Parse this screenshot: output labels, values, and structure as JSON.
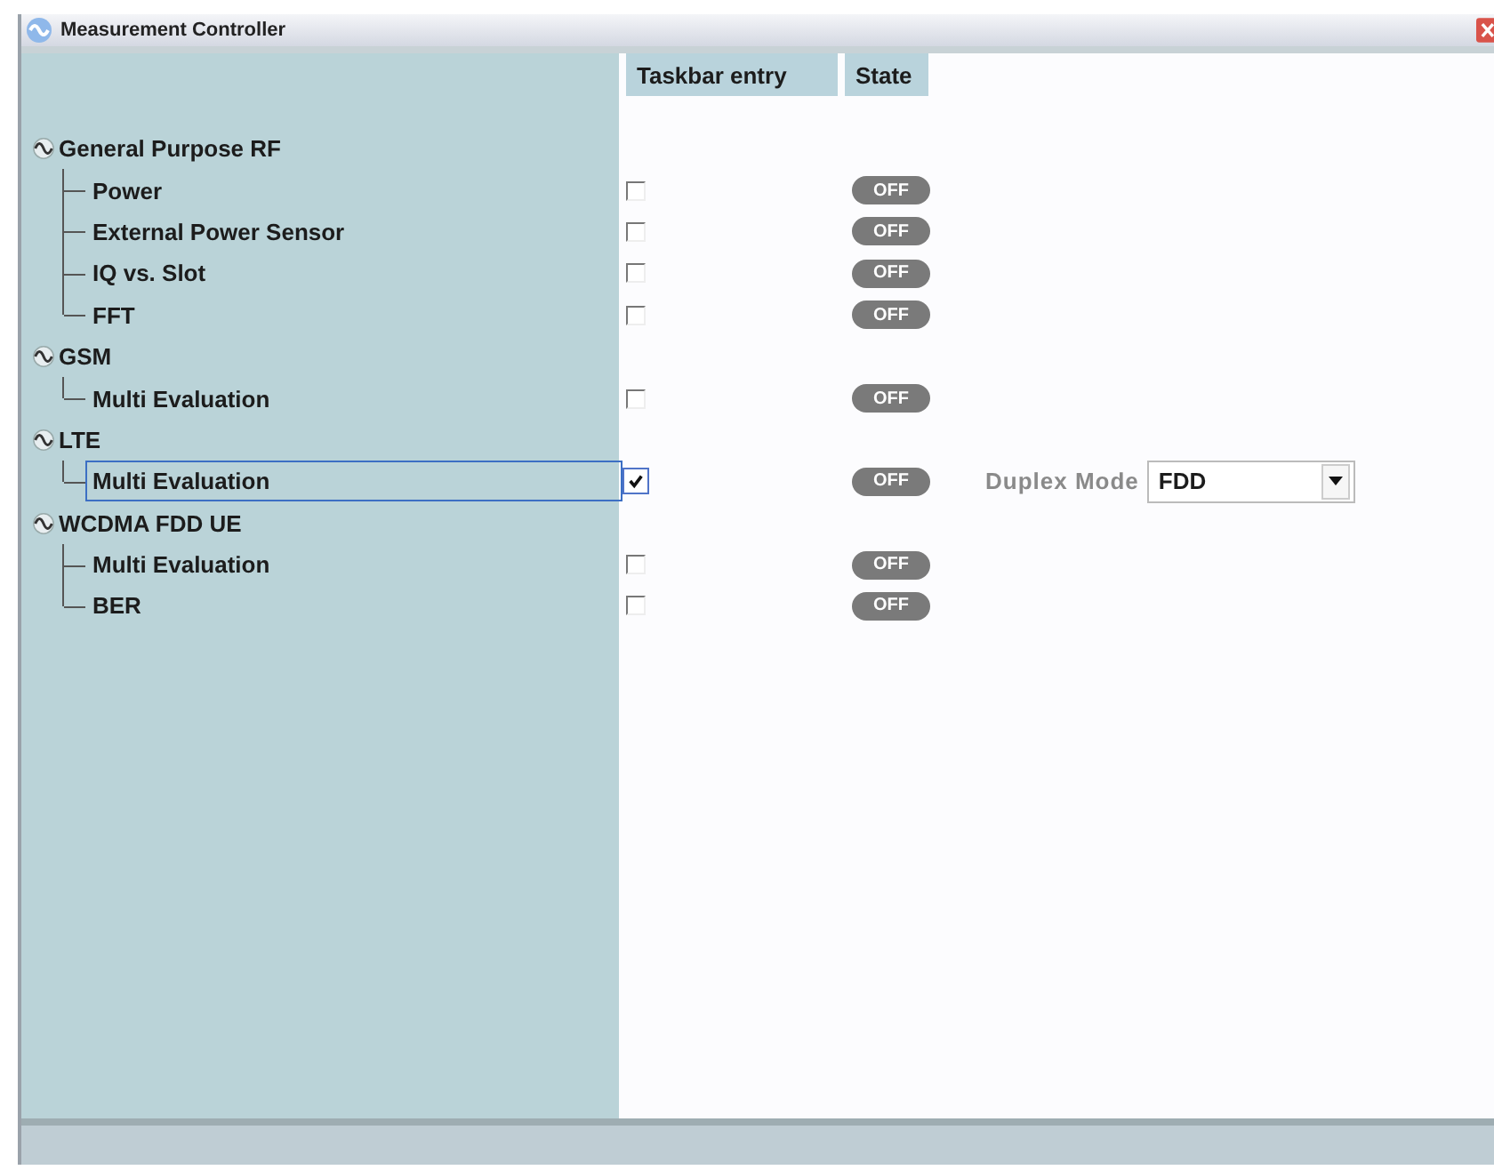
{
  "window": {
    "title": "Measurement Controller"
  },
  "columns": [
    "Taskbar entry",
    "State"
  ],
  "groups": [
    {
      "label": "General Purpose RF",
      "children": [
        {
          "label": "Power",
          "taskbar_entry": false,
          "state": "OFF",
          "selected": false
        },
        {
          "label": "External Power Sensor",
          "taskbar_entry": false,
          "state": "OFF",
          "selected": false
        },
        {
          "label": "IQ vs. Slot",
          "taskbar_entry": false,
          "state": "OFF",
          "selected": false
        },
        {
          "label": "FFT",
          "taskbar_entry": false,
          "state": "OFF",
          "selected": false
        }
      ]
    },
    {
      "label": "GSM",
      "children": [
        {
          "label": "Multi Evaluation",
          "taskbar_entry": false,
          "state": "OFF",
          "selected": false
        }
      ]
    },
    {
      "label": "LTE",
      "children": [
        {
          "label": "Multi Evaluation",
          "taskbar_entry": true,
          "state": "OFF",
          "selected": true,
          "setting": {
            "label": "Duplex Mode",
            "value": "FDD"
          }
        }
      ]
    },
    {
      "label": "WCDMA FDD UE",
      "children": [
        {
          "label": "Multi Evaluation",
          "taskbar_entry": false,
          "state": "OFF",
          "selected": false
        },
        {
          "label": "BER",
          "taskbar_entry": false,
          "state": "OFF",
          "selected": false
        }
      ]
    }
  ]
}
